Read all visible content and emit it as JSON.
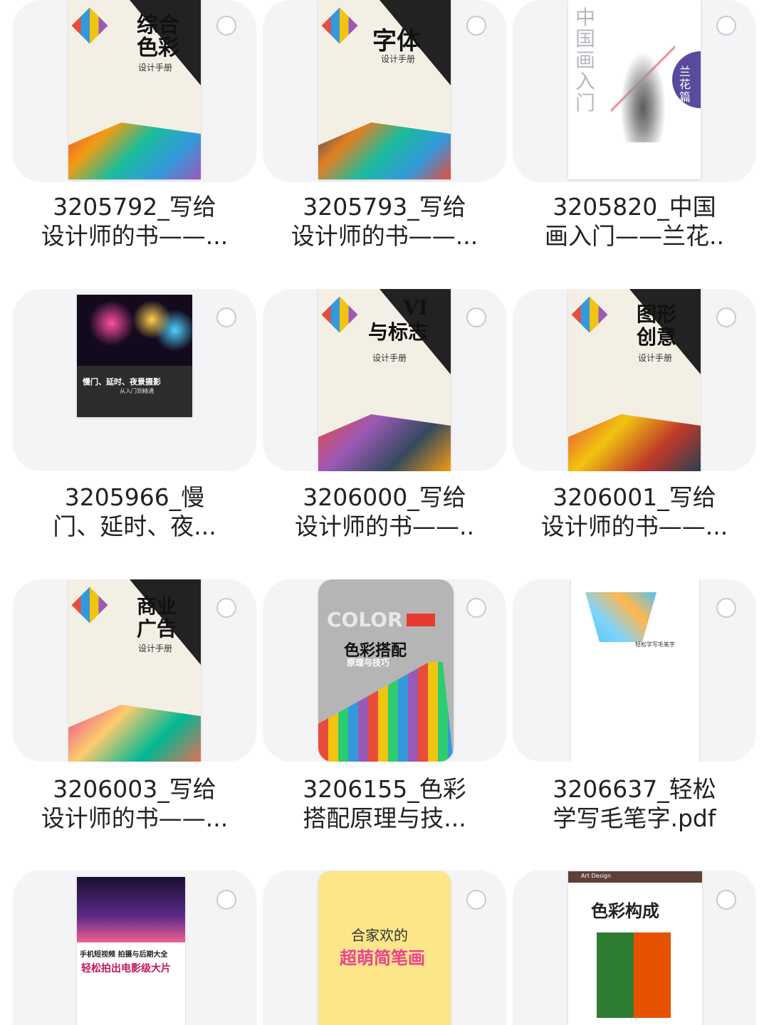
{
  "files": [
    {
      "line1": "3205792_写给",
      "line2": "设计师的书——...",
      "cover_title": "综合\n色彩",
      "cover_sub": "设计手册"
    },
    {
      "line1": "3205793_写给",
      "line2": "设计师的书——...",
      "cover_title": "字体",
      "cover_sub": "设计手册"
    },
    {
      "line1": "3205820_中国",
      "line2": "画入门——兰花..",
      "cover_title": "中国画入门",
      "cover_sub": "兰花篇"
    },
    {
      "line1": "3205966_慢",
      "line2": "门、延时、夜...",
      "cover_title": "慢门、延时、夜景摄影",
      "cover_sub": "从入门到精通"
    },
    {
      "line1": "3206000_写给",
      "line2": "设计师的书——..",
      "cover_title": "VI\n与标志",
      "cover_sub": "设计手册"
    },
    {
      "line1": "3206001_写给",
      "line2": "设计师的书——...",
      "cover_title": "图形\n创意",
      "cover_sub": "设计手册"
    },
    {
      "line1": "3206003_写给",
      "line2": "设计师的书——...",
      "cover_title": "商业\n广告",
      "cover_sub": "设计手册"
    },
    {
      "line1": "3206155_色彩",
      "line2": "搭配原理与技...",
      "cover_title": "色彩搭配",
      "cover_sub": "原理与技巧",
      "cover_extra": "COLOR"
    },
    {
      "line1": "3206637_轻松",
      "line2": "学写毛笔字.pdf",
      "cover_title": "轻松学写毛笔字",
      "cover_sub": ""
    },
    {
      "line1": "",
      "line2": "",
      "cover_title": "手机短视频 拍摄与后期大全",
      "cover_sub": "轻松拍出电影级大片"
    },
    {
      "line1": "",
      "line2": "",
      "cover_title": "合家欢的",
      "cover_sub": "超萌简笔画"
    },
    {
      "line1": "",
      "line2": "",
      "cover_title": "色彩构成",
      "cover_sub": "Art Design"
    }
  ],
  "colors": {
    "tile_bg": "#f4f4f6",
    "text": "#222222",
    "radio_border": "#c9c9cf"
  },
  "icons": {
    "select": "radio-circle-icon"
  }
}
